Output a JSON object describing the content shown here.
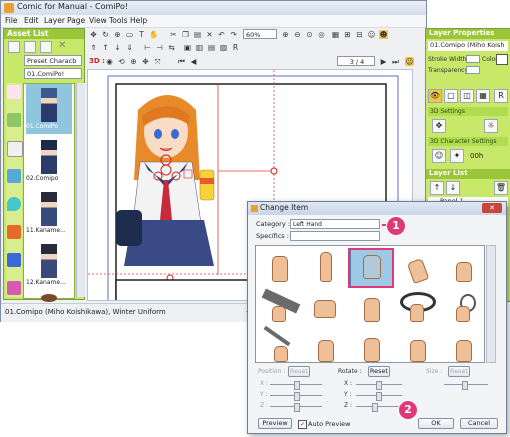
{
  "window": {
    "title": "Comic for Manual - ComiPo!"
  },
  "menu": [
    "File",
    "Edit",
    "Layer",
    "Page",
    "View",
    "Tools",
    "Help"
  ],
  "toolbar": {
    "zoom": "60%",
    "page": "3 / 4",
    "mode_3d": "3D :"
  },
  "asset_list": {
    "title": "Asset List",
    "preset": "Preset Characb",
    "character": "01.ComiPo!",
    "items": [
      "01.ComiPo",
      "02.Comipo",
      "11.Kaname...",
      "12.Kaname...",
      "13..."
    ]
  },
  "layer_properties": {
    "title": "Layer Properties",
    "character_name": "01.Comipo (Miho Koish",
    "stroke_width_label": "Stroke Width",
    "color_label": "Color",
    "transparency_label": "Transparency",
    "section_3d": "3D Settings",
    "section_3d_char": "3D Character Settings",
    "ooh": "00h"
  },
  "layer_list": {
    "title": "Layer List",
    "panel": "Panel 1"
  },
  "status": {
    "text": "01.Comipo (Miho Koishikawa), Winter Uniform",
    "right": "-1"
  },
  "dialog": {
    "title": "Change Item",
    "category_label": "Category :",
    "category_value": "Left Hand",
    "specifics_label": "Specifics :",
    "position_label": "Position :",
    "rotate_label": "Rotate :",
    "size_label": "Size :",
    "reset_label": "Reset",
    "axes": [
      "X :",
      "Y :",
      "Z :"
    ],
    "preview_label": "Preview",
    "auto_preview_label": "Auto Preview",
    "ok_label": "OK",
    "cancel_label": "Cancel"
  },
  "callouts": [
    "1",
    "2"
  ],
  "colors": {
    "panel_green": "#c8e86a",
    "header_green": "#9cc63a",
    "accent_pink": "#e0397a"
  }
}
